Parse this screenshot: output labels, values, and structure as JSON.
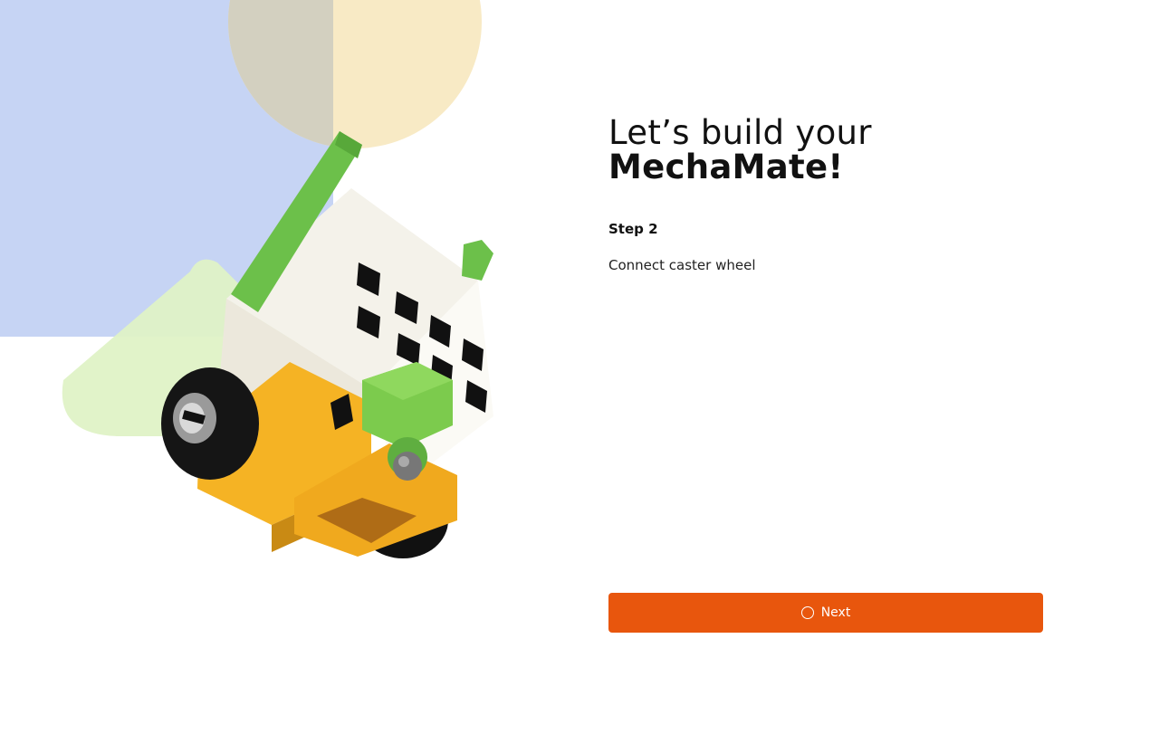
{
  "heading": {
    "line1": "Let’s build your",
    "line2": "MechaMate!"
  },
  "step": {
    "label": "Step 2",
    "description": "Connect caster wheel"
  },
  "next_button": {
    "label": "Next",
    "icon": "loading-circle-icon"
  },
  "colors": {
    "accent": "#e8560d",
    "bg_blue": "#c6d4f4",
    "bg_yellow": "#f8eac5",
    "bg_green": "#dff2c6"
  },
  "illustration": {
    "subject": "robot"
  }
}
